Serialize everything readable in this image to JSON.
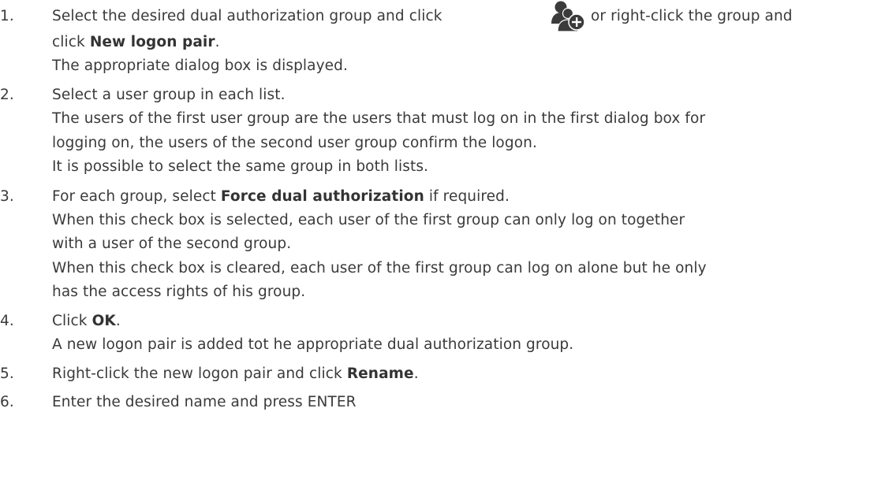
{
  "steps": [
    {
      "number": "1.",
      "line1_a": "Select the desired dual authorization group and click",
      "line1_b": "or right-click the group and",
      "line2_a": "click ",
      "line2_bold": "New logon pair",
      "line2_c": ".",
      "result": "The appropriate dialog box is displayed.",
      "icon": "add-user-group-icon"
    },
    {
      "number": "2.",
      "text": "Select a user group in each list.",
      "detail_1": "The users of the first user group are the users that must log on in the first dialog box for",
      "detail_2": "logging on, the users of the second user group confirm the logon.",
      "detail_3": "It is possible to select the same group in both lists."
    },
    {
      "number": "3.",
      "text_a": "For each group, select ",
      "text_bold": "Force dual authorization",
      "text_c": " if required.",
      "detail_1": "When this check box is selected, each user of the first group can only log on together",
      "detail_2": "with a user of the second group.",
      "detail_3": "When this check box is cleared, each user of the first group can log on alone but he only",
      "detail_4": "has the access rights of his group."
    },
    {
      "number": "4.",
      "text_a": "Click ",
      "text_bold": "OK",
      "text_c": ".",
      "result": "A new logon pair is added tot he appropriate dual authorization group."
    },
    {
      "number": "5.",
      "text_a": "Right-click the new logon pair and click ",
      "text_bold": "Rename",
      "text_c": "."
    },
    {
      "number": "6.",
      "text": "Enter the desired name and press ENTER"
    }
  ],
  "colors": {
    "text": "#3a3a3a",
    "icon_dark": "#3b3b3b",
    "icon_light": "#ffffff"
  }
}
